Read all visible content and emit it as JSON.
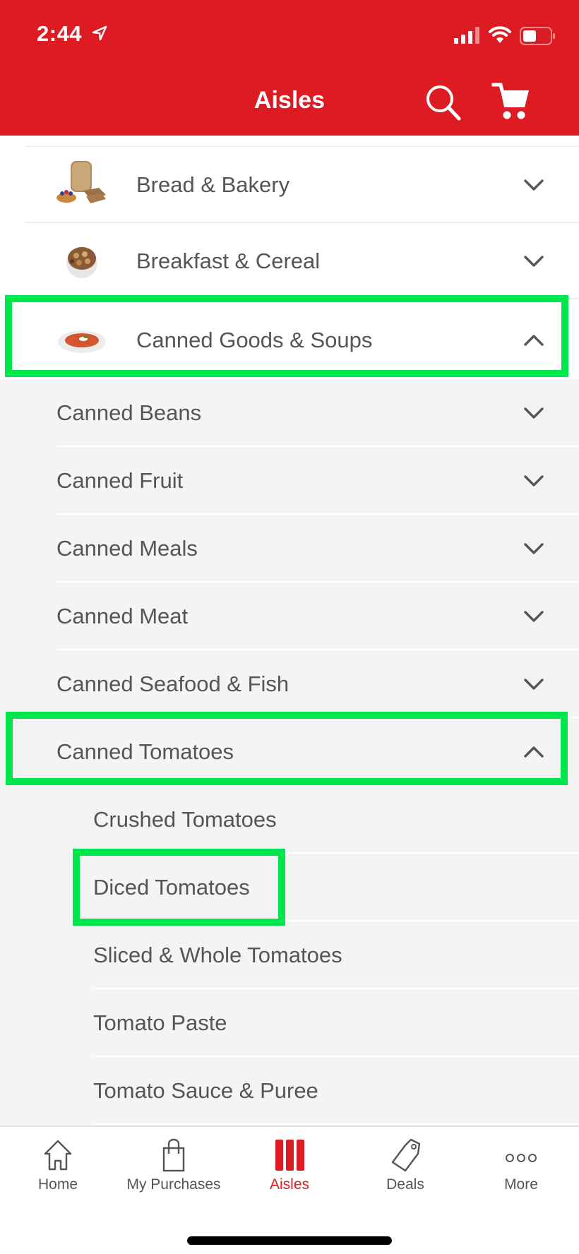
{
  "status_bar": {
    "time": "2:44",
    "location_icon": "location-arrow-icon",
    "signal_bars": 3,
    "signal_bars_total": 4,
    "battery_percent": 50
  },
  "header": {
    "title": "Aisles",
    "search_icon": "search-icon",
    "cart_icon": "cart-icon",
    "background": "#dc1c22"
  },
  "categories": [
    {
      "label": "Bread & Bakery",
      "icon": "bread-thumbnail",
      "expanded": false
    },
    {
      "label": "Breakfast & Cereal",
      "icon": "cereal-thumbnail",
      "expanded": false
    },
    {
      "label": "Canned Goods & Soups",
      "icon": "soup-thumbnail",
      "expanded": true,
      "highlighted": true
    }
  ],
  "subcategories": [
    {
      "label": "Canned Beans",
      "expanded": false
    },
    {
      "label": "Canned Fruit",
      "expanded": false
    },
    {
      "label": "Canned Meals",
      "expanded": false
    },
    {
      "label": "Canned Meat",
      "expanded": false
    },
    {
      "label": "Canned Seafood & Fish",
      "expanded": false
    },
    {
      "label": "Canned Tomatoes",
      "expanded": true,
      "highlighted": true
    }
  ],
  "leaf_items": [
    {
      "label": "Crushed Tomatoes"
    },
    {
      "label": "Diced Tomatoes",
      "highlighted": true
    },
    {
      "label": "Sliced & Whole Tomatoes"
    },
    {
      "label": "Tomato Paste"
    },
    {
      "label": "Tomato Sauce & Puree"
    }
  ],
  "highlight_color": "#00e64d",
  "tabbar": {
    "items": [
      {
        "label": "Home",
        "icon": "home-icon",
        "active": false
      },
      {
        "label": "My Purchases",
        "icon": "shopping-bag-icon",
        "active": false
      },
      {
        "label": "Aisles",
        "icon": "aisles-icon",
        "active": true
      },
      {
        "label": "Deals",
        "icon": "tag-icon",
        "active": false
      },
      {
        "label": "More",
        "icon": "more-dots-icon",
        "active": false
      }
    ],
    "active_color": "#dc1c22"
  }
}
